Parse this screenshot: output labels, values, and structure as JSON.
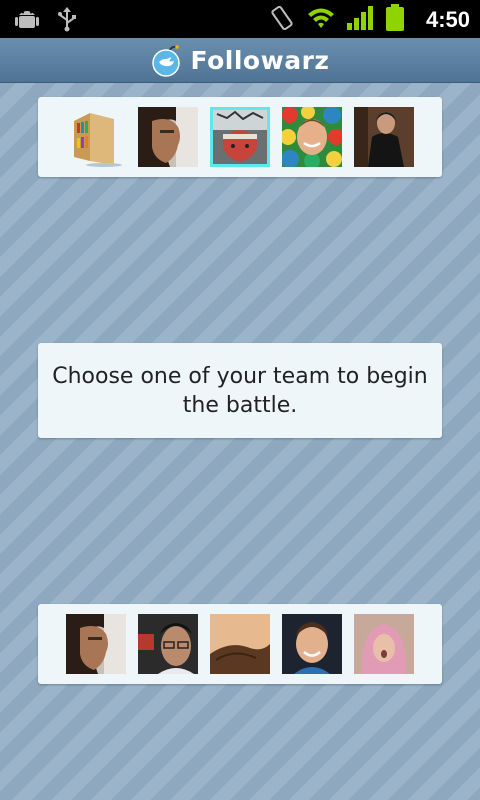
{
  "status_bar": {
    "time": "4:50",
    "icons": [
      "android-debug-icon",
      "usb-icon",
      "rotate-icon",
      "wifi-icon",
      "signal-icon",
      "battery-icon"
    ]
  },
  "header": {
    "title": "Followarz"
  },
  "message": {
    "text": "Choose one of your team to begin the battle."
  },
  "top_team": {
    "avatars": [
      {
        "name": "bookshelf-avatar",
        "selected": false
      },
      {
        "name": "man-profile-avatar",
        "selected": false
      },
      {
        "name": "headband-avatar",
        "selected": true
      },
      {
        "name": "ballpit-avatar",
        "selected": false
      },
      {
        "name": "leather-jacket-avatar",
        "selected": false
      }
    ]
  },
  "bottom_team": {
    "avatars": [
      {
        "name": "man-profile-avatar",
        "selected": false
      },
      {
        "name": "man-glasses-avatar",
        "selected": false
      },
      {
        "name": "hair-closeup-avatar",
        "selected": false
      },
      {
        "name": "smiling-man-avatar",
        "selected": false
      },
      {
        "name": "pink-hood-avatar",
        "selected": false
      }
    ]
  },
  "colors": {
    "statusbar": "#000000",
    "titlebar": "#5a7fa2",
    "panel": "#eef6f9",
    "selection": "#5fe7ec",
    "background_stripe_a": "#8ea8bf",
    "background_stripe_b": "#9bb4c9"
  }
}
